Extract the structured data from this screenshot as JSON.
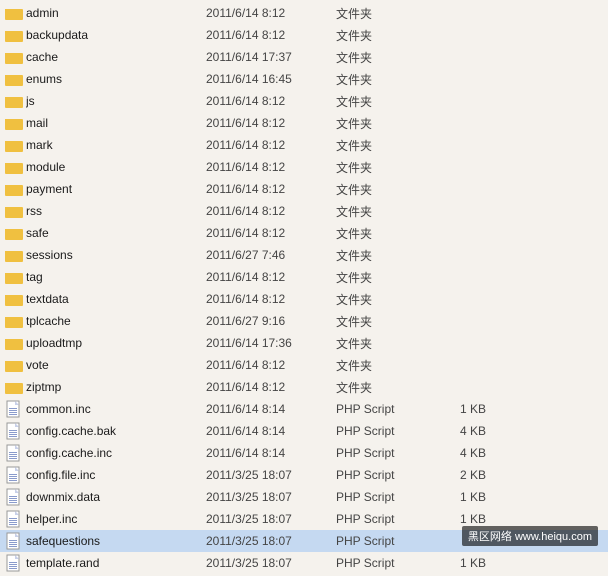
{
  "files": [
    {
      "name": "admin",
      "date": "2011/6/14 8:12",
      "type": "文件夹",
      "size": "",
      "kind": "folder"
    },
    {
      "name": "backupdata",
      "date": "2011/6/14 8:12",
      "type": "文件夹",
      "size": "",
      "kind": "folder"
    },
    {
      "name": "cache",
      "date": "2011/6/14 17:37",
      "type": "文件夹",
      "size": "",
      "kind": "folder"
    },
    {
      "name": "enums",
      "date": "2011/6/14 16:45",
      "type": "文件夹",
      "size": "",
      "kind": "folder"
    },
    {
      "name": "js",
      "date": "2011/6/14 8:12",
      "type": "文件夹",
      "size": "",
      "kind": "folder"
    },
    {
      "name": "mail",
      "date": "2011/6/14 8:12",
      "type": "文件夹",
      "size": "",
      "kind": "folder"
    },
    {
      "name": "mark",
      "date": "2011/6/14 8:12",
      "type": "文件夹",
      "size": "",
      "kind": "folder"
    },
    {
      "name": "module",
      "date": "2011/6/14 8:12",
      "type": "文件夹",
      "size": "",
      "kind": "folder"
    },
    {
      "name": "payment",
      "date": "2011/6/14 8:12",
      "type": "文件夹",
      "size": "",
      "kind": "folder"
    },
    {
      "name": "rss",
      "date": "2011/6/14 8:12",
      "type": "文件夹",
      "size": "",
      "kind": "folder"
    },
    {
      "name": "safe",
      "date": "2011/6/14 8:12",
      "type": "文件夹",
      "size": "",
      "kind": "folder"
    },
    {
      "name": "sessions",
      "date": "2011/6/27 7:46",
      "type": "文件夹",
      "size": "",
      "kind": "folder"
    },
    {
      "name": "tag",
      "date": "2011/6/14 8:12",
      "type": "文件夹",
      "size": "",
      "kind": "folder"
    },
    {
      "name": "textdata",
      "date": "2011/6/14 8:12",
      "type": "文件夹",
      "size": "",
      "kind": "folder"
    },
    {
      "name": "tplcache",
      "date": "2011/6/27 9:16",
      "type": "文件夹",
      "size": "",
      "kind": "folder"
    },
    {
      "name": "uploadtmp",
      "date": "2011/6/14 17:36",
      "type": "文件夹",
      "size": "",
      "kind": "folder"
    },
    {
      "name": "vote",
      "date": "2011/6/14 8:12",
      "type": "文件夹",
      "size": "",
      "kind": "folder"
    },
    {
      "name": "ziptmp",
      "date": "2011/6/14 8:12",
      "type": "文件夹",
      "size": "",
      "kind": "folder"
    },
    {
      "name": "common.inc",
      "date": "2011/6/14 8:14",
      "type": "PHP Script",
      "size": "1 KB",
      "kind": "php"
    },
    {
      "name": "config.cache.bak",
      "date": "2011/6/14 8:14",
      "type": "PHP Script",
      "size": "4 KB",
      "kind": "php"
    },
    {
      "name": "config.cache.inc",
      "date": "2011/6/14 8:14",
      "type": "PHP Script",
      "size": "4 KB",
      "kind": "php"
    },
    {
      "name": "config.file.inc",
      "date": "2011/3/25 18:07",
      "type": "PHP Script",
      "size": "2 KB",
      "kind": "php"
    },
    {
      "name": "downmix.data",
      "date": "2011/3/25 18:07",
      "type": "PHP Script",
      "size": "1 KB",
      "kind": "php"
    },
    {
      "name": "helper.inc",
      "date": "2011/3/25 18:07",
      "type": "PHP Script",
      "size": "1 KB",
      "kind": "php"
    },
    {
      "name": "safequestions",
      "date": "2011/3/25 18:07",
      "type": "PHP Script",
      "size": "",
      "kind": "php",
      "selected": true
    },
    {
      "name": "template.rand",
      "date": "2011/3/25 18:07",
      "type": "PHP Script",
      "size": "1 KB",
      "kind": "php"
    }
  ],
  "watermark": "黑区网络 www.heiqu.com"
}
